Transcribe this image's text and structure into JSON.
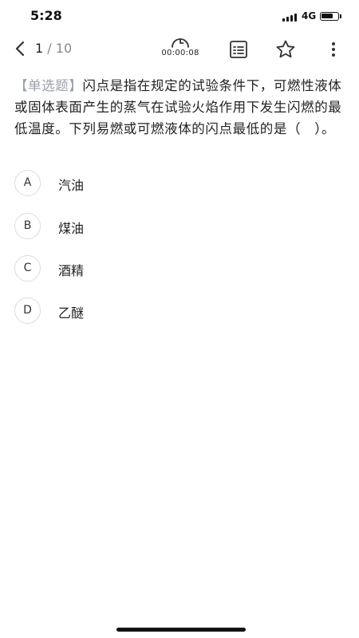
{
  "status_bar": {
    "time": "5:28",
    "network": "4G",
    "battery_level": 0.75
  },
  "toolbar": {
    "current": "1",
    "separator": "/",
    "total": "10",
    "timer": "00:00:08"
  },
  "question": {
    "type_label": "【单选题】",
    "text": "闪点是指在规定的试验条件下，可燃性液体或固体表面产生的蒸气在试验火焰作用下发生闪燃的最低温度。下列易燃或可燃液体的闪点最低的是（　）。"
  },
  "options": [
    {
      "letter": "A",
      "text": "汽油"
    },
    {
      "letter": "B",
      "text": "煤油"
    },
    {
      "letter": "C",
      "text": "酒精"
    },
    {
      "letter": "D",
      "text": "乙醚"
    }
  ],
  "icons": {
    "back": "chevron-left-icon",
    "timer": "clock-icon",
    "answer_sheet": "answer-sheet-icon",
    "favorite": "star-icon",
    "more": "more-vertical-icon"
  }
}
